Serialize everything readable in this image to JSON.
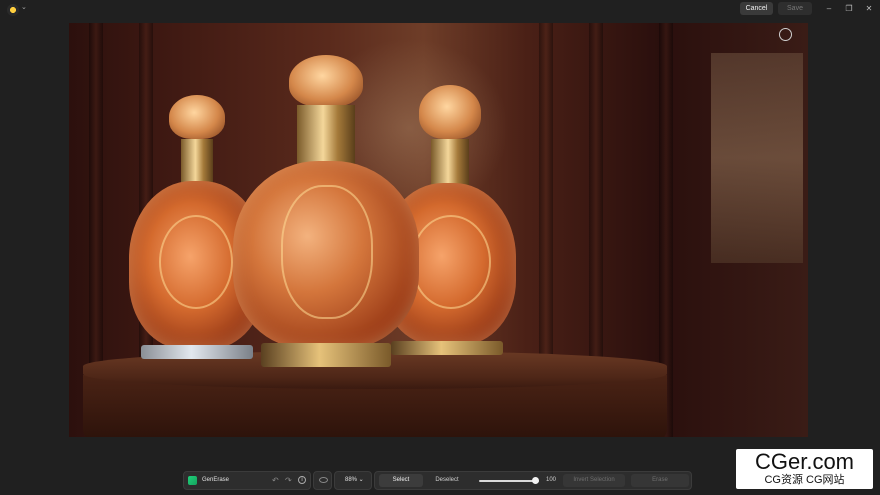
{
  "titlebar": {
    "cancel_label": "Cancel",
    "save_label": "Save",
    "minimize_glyph": "–",
    "restore_glyph": "❐",
    "close_glyph": "✕",
    "logo_caret": "⌄"
  },
  "toolbar": {
    "tool_name": "GenErase",
    "undo_glyph": "↶",
    "redo_glyph": "↷",
    "info_glyph": "i",
    "zoom_label": "88% ⌄",
    "select_label": "Select",
    "deselect_label": "Deselect",
    "brush_size_value": "100",
    "brush_size_fraction": 0.93,
    "invert_label": "Invert Selection",
    "erase_label": "Erase"
  },
  "watermark": {
    "main": "CGer.com",
    "sub": "CG资源 CG网站"
  },
  "colors": {
    "accent_green": "#1fd17a",
    "background": "#202020"
  }
}
